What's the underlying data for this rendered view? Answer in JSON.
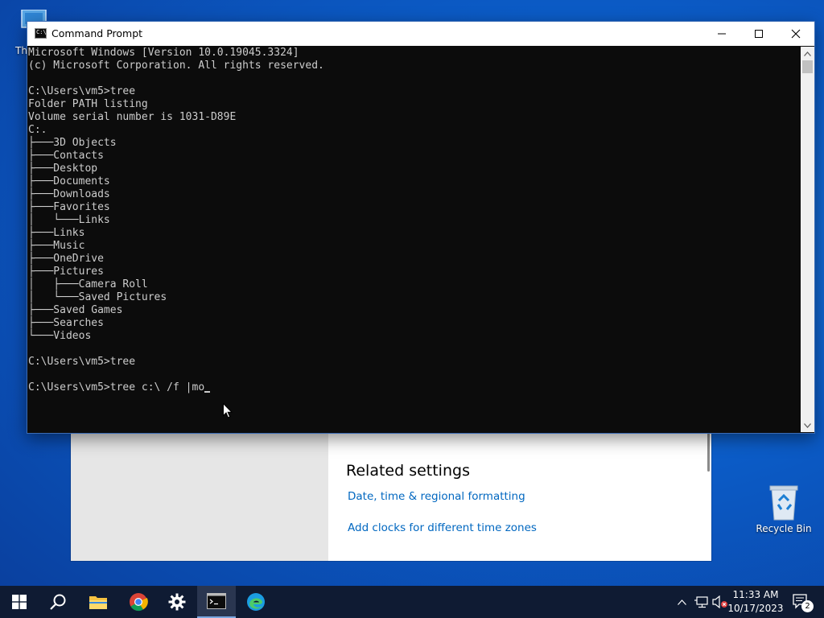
{
  "desktop": {
    "this_pc_label": "Th",
    "recycle_bin_label": "Recycle Bin"
  },
  "settings_window": {
    "related_settings_heading": "Related settings",
    "link_date_time": "Date, time & regional formatting",
    "link_add_clocks": "Add clocks for different time zones"
  },
  "cmd_window": {
    "title": "Command Prompt",
    "minimize_label": "Minimize",
    "maximize_label": "Maximize",
    "close_label": "Close",
    "lines": [
      "Microsoft Windows [Version 10.0.19045.3324]",
      "(c) Microsoft Corporation. All rights reserved.",
      "",
      "C:\\Users\\vm5>tree",
      "Folder PATH listing",
      "Volume serial number is 1031-D89E",
      "C:.",
      "├───3D Objects",
      "├───Contacts",
      "├───Desktop",
      "├───Documents",
      "├───Downloads",
      "├───Favorites",
      "│   └───Links",
      "├───Links",
      "├───Music",
      "├───OneDrive",
      "├───Pictures",
      "│   ├───Camera Roll",
      "│   └───Saved Pictures",
      "├───Saved Games",
      "├───Searches",
      "└───Videos",
      "",
      "C:\\Users\\vm5>tree",
      "",
      "C:\\Users\\vm5>tree c:\\ /f |mo"
    ]
  },
  "taskbar": {
    "items": [
      "start-button",
      "search",
      "file-explorer",
      "chrome",
      "settings",
      "command-prompt",
      "edge"
    ],
    "clock_time": "11:33 AM",
    "clock_date": "10/17/2023",
    "notification_count": "2"
  },
  "colors": {
    "console_bg": "#0c0c0c",
    "console_fg": "#cccccc",
    "link": "#0067c0",
    "taskbar_bg": "#0f1b33"
  }
}
